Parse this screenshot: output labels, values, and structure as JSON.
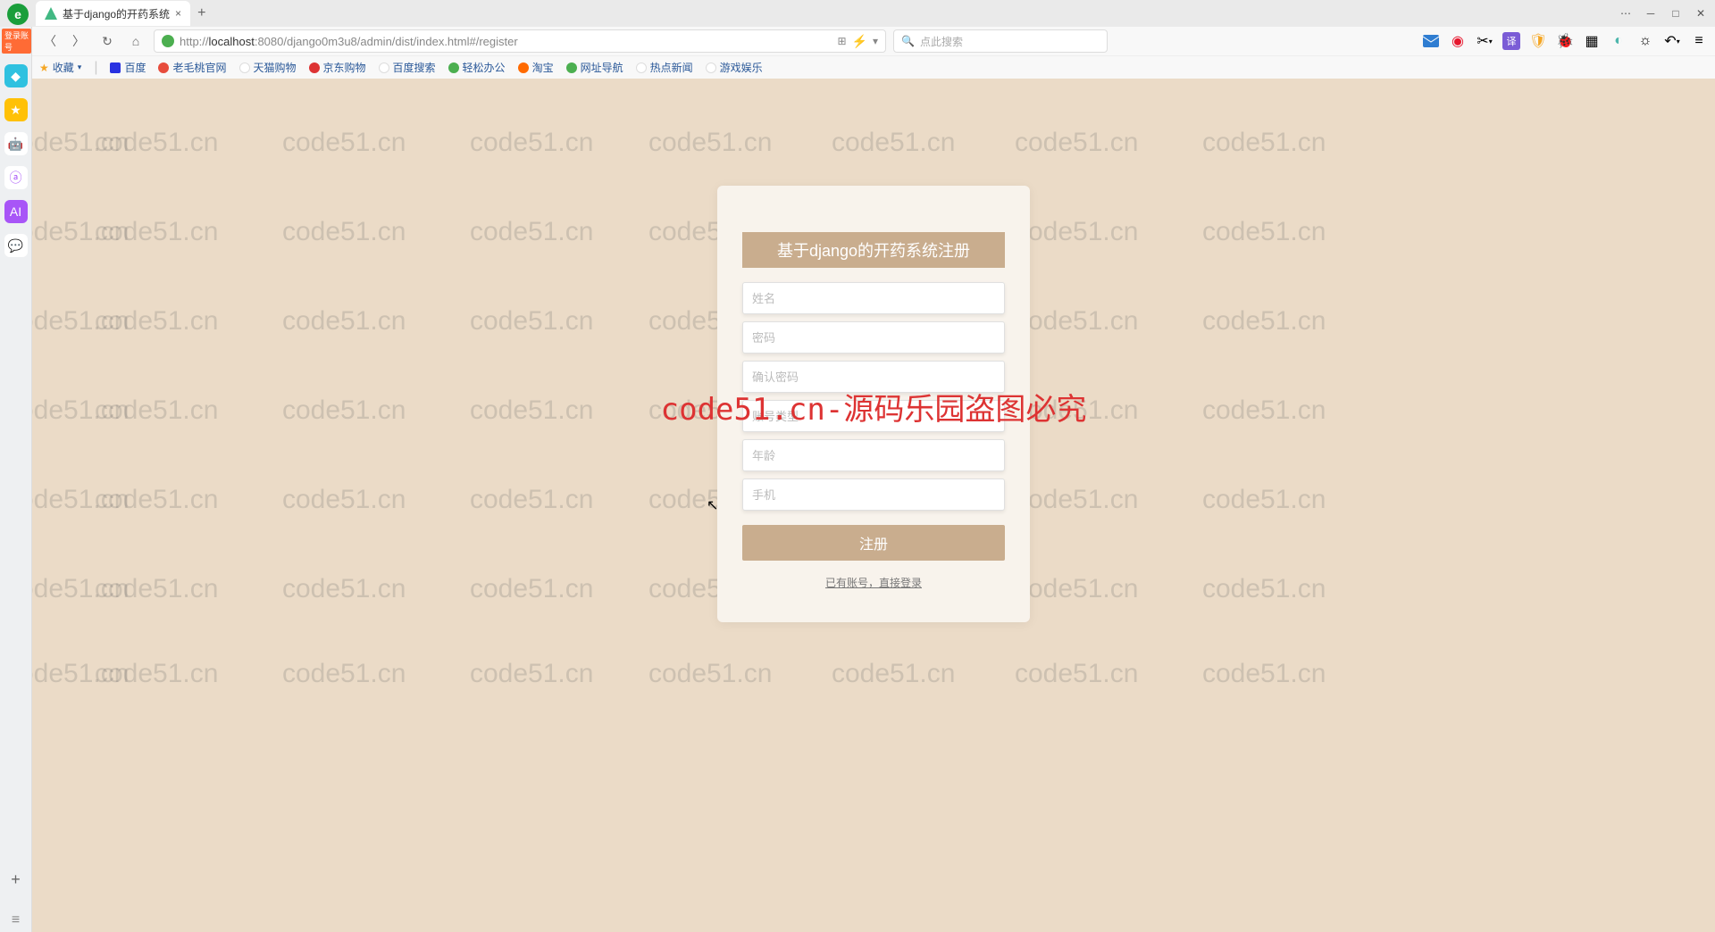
{
  "browser": {
    "tab_title": "基于django的开药系统",
    "url_prefix": "http://",
    "url_host": "localhost",
    "url_port_path": ":8080/django0m3u8/admin/dist/index.html#/register",
    "search_placeholder": "点此搜索",
    "login_badge": "登录账号"
  },
  "window_controls": {
    "minimize": "─",
    "maximize": "□",
    "close": "✕",
    "menu": "⋯"
  },
  "nav": {
    "back": "〈",
    "forward": "〉",
    "reload": "↻",
    "home": "⌂"
  },
  "bookmarks": {
    "fav": "收藏",
    "items": [
      {
        "label": "百度",
        "color": "#2b5999"
      },
      {
        "label": "老毛桃官网",
        "color": "#2b5999"
      },
      {
        "label": "天猫购物",
        "color": "#2b5999"
      },
      {
        "label": "京东购物",
        "color": "#d33"
      },
      {
        "label": "百度搜索",
        "color": "#2b5999"
      },
      {
        "label": "轻松办公",
        "color": "#2b5999"
      },
      {
        "label": "淘宝",
        "color": "#ff6a00"
      },
      {
        "label": "网址导航",
        "color": "#2b5999"
      },
      {
        "label": "热点新闻",
        "color": "#2b5999"
      },
      {
        "label": "游戏娱乐",
        "color": "#2b5999"
      }
    ]
  },
  "watermark": {
    "text": "code51.cn",
    "main": "code51.cn-源码乐园盗图必究"
  },
  "form": {
    "title": "基于django的开药系统注册",
    "fields": {
      "name": "姓名",
      "password": "密码",
      "confirm": "确认密码",
      "type": "账号类型",
      "age": "年龄",
      "phone": "手机"
    },
    "submit": "注册",
    "login_link": "已有账号，直接登录"
  },
  "toolbar_icons": {
    "mail": "#2f7dd1",
    "weibo": "#e6162d",
    "scissors": "#555",
    "translate": "#7b5cd6",
    "shield": "#f5a623",
    "search": "#555",
    "apps": "#555",
    "ext": "#4db6ac",
    "settings": "#888",
    "reload2": "#888",
    "menu": "#888"
  }
}
